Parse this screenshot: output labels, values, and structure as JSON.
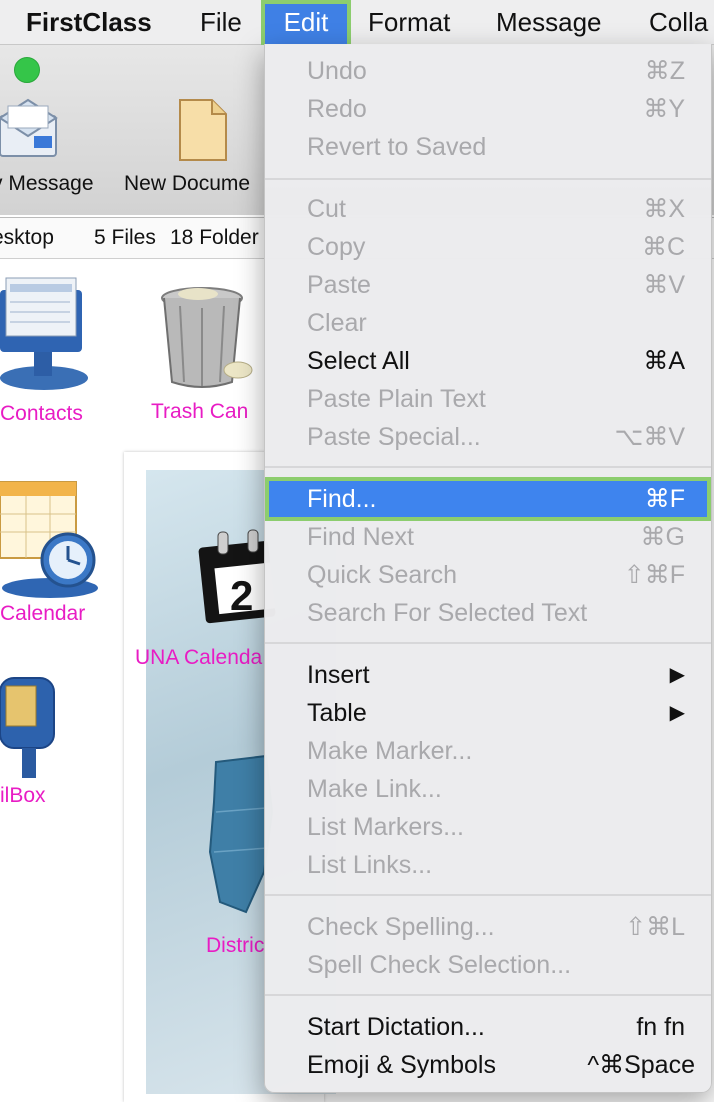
{
  "menubar": {
    "app": "FirstClass",
    "items": [
      "File",
      "Edit",
      "Format",
      "Message",
      "Colla"
    ]
  },
  "toolbar": {
    "new_message": "v Message",
    "new_document": "New Docume"
  },
  "statusbar": {
    "path": "esktop",
    "files": "5 Files",
    "folders": "18 Folder"
  },
  "desktop": {
    "contacts": "Contacts",
    "trash": "Trash Can",
    "calendar": "Calendar",
    "una_calendar": "UNA Calenda",
    "mailbox": "ilBox",
    "district": "Distric",
    "calendar_digit": "2"
  },
  "edit_menu": {
    "undo": {
      "label": "Undo",
      "key": "⌘Z"
    },
    "redo": {
      "label": "Redo",
      "key": "⌘Y"
    },
    "revert": {
      "label": "Revert to Saved",
      "key": ""
    },
    "cut": {
      "label": "Cut",
      "key": "⌘X"
    },
    "copy": {
      "label": "Copy",
      "key": "⌘C"
    },
    "paste": {
      "label": "Paste",
      "key": "⌘V"
    },
    "clear": {
      "label": "Clear",
      "key": ""
    },
    "select_all": {
      "label": "Select All",
      "key": "⌘A"
    },
    "paste_plain": {
      "label": "Paste Plain Text",
      "key": ""
    },
    "paste_special": {
      "label": "Paste Special...",
      "key": "⌥⌘V"
    },
    "find": {
      "label": "Find...",
      "key": "⌘F"
    },
    "find_next": {
      "label": "Find Next",
      "key": "⌘G"
    },
    "quick_search": {
      "label": "Quick Search",
      "key": "⇧⌘F"
    },
    "search_selected": {
      "label": "Search For Selected Text",
      "key": ""
    },
    "insert": {
      "label": "Insert",
      "key": "▶"
    },
    "table": {
      "label": "Table",
      "key": "▶"
    },
    "make_marker": {
      "label": "Make Marker...",
      "key": ""
    },
    "make_link": {
      "label": "Make Link...",
      "key": ""
    },
    "list_markers": {
      "label": "List Markers...",
      "key": ""
    },
    "list_links": {
      "label": "List Links...",
      "key": ""
    },
    "check_spelling": {
      "label": "Check Spelling...",
      "key": "⇧⌘L"
    },
    "spell_check_selection": {
      "label": "Spell Check Selection...",
      "key": ""
    },
    "start_dictation": {
      "label": "Start Dictation...",
      "key": "fn fn"
    },
    "emoji": {
      "label": "Emoji & Symbols",
      "key": "^⌘Space"
    }
  },
  "colors": {
    "highlight": "#3e84ee",
    "annotation_outline": "#8ccd6e",
    "desktop_label": "#e81cc4",
    "disabled_text": "#a9a9ac"
  }
}
